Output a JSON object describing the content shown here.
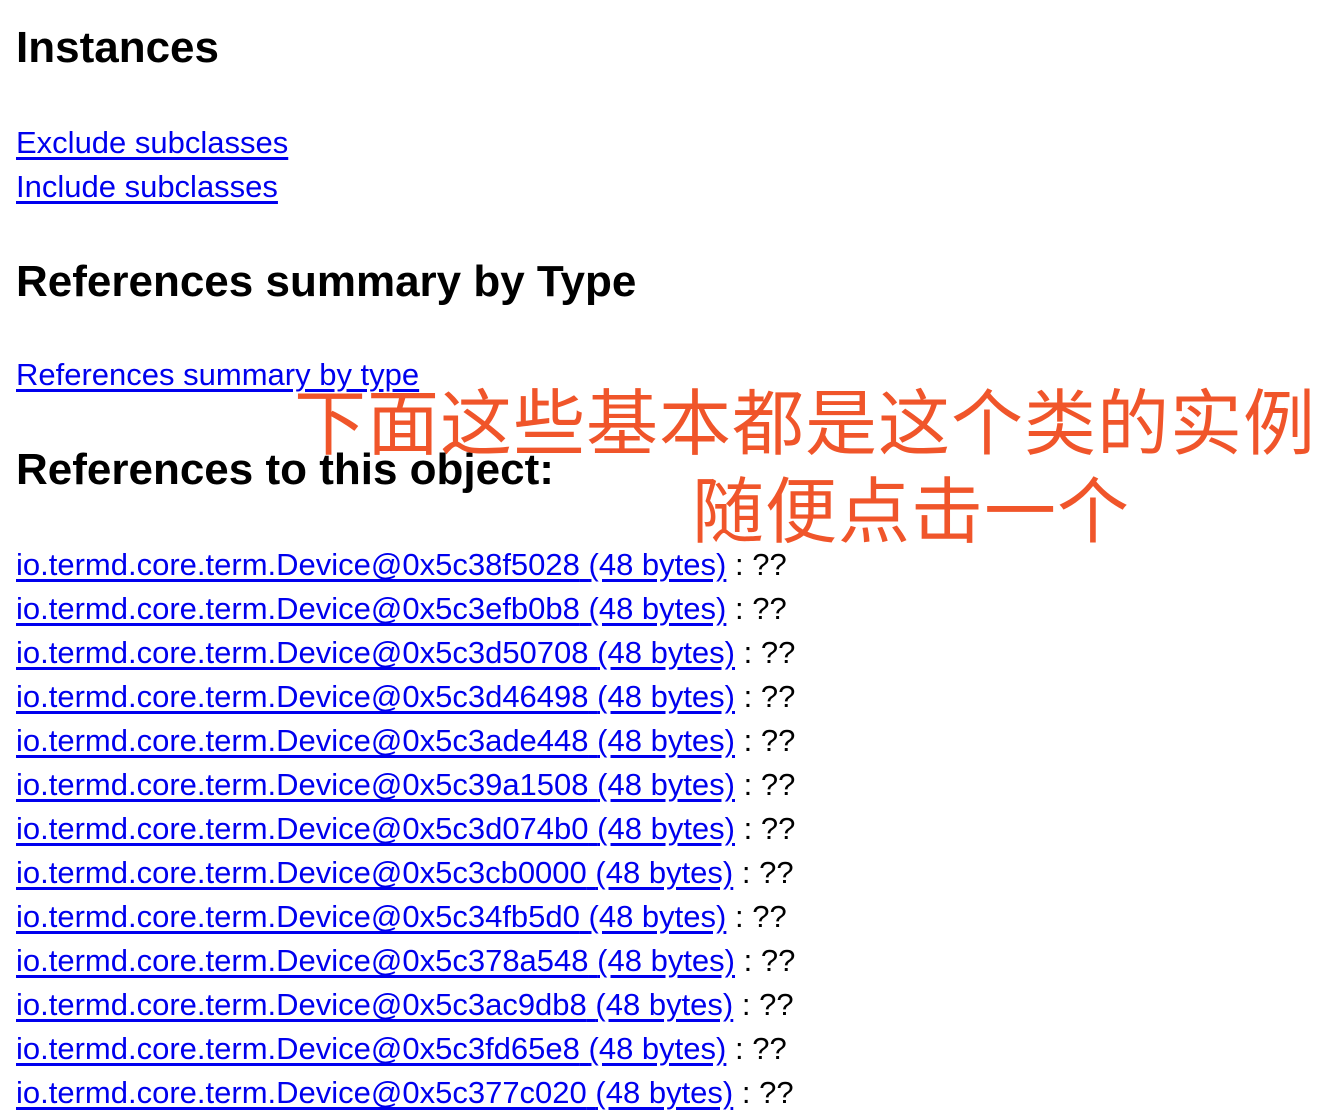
{
  "sections": {
    "instances": {
      "heading": "Instances",
      "links": [
        "Exclude subclasses",
        "Include subclasses"
      ]
    },
    "references_summary": {
      "heading": "References summary by Type",
      "link": "References summary by type"
    },
    "references_to_object": {
      "heading": "References to this object:",
      "items": [
        {
          "object": "io.termd.core.term.Device@0x5c38f5028",
          "size": "(48 bytes)",
          "suffix": " : ??"
        },
        {
          "object": "io.termd.core.term.Device@0x5c3efb0b8",
          "size": "(48 bytes)",
          "suffix": " : ??"
        },
        {
          "object": "io.termd.core.term.Device@0x5c3d50708",
          "size": "(48 bytes)",
          "suffix": " : ??"
        },
        {
          "object": "io.termd.core.term.Device@0x5c3d46498",
          "size": "(48 bytes)",
          "suffix": " : ??"
        },
        {
          "object": "io.termd.core.term.Device@0x5c3ade448",
          "size": "(48 bytes)",
          "suffix": " : ??"
        },
        {
          "object": "io.termd.core.term.Device@0x5c39a1508",
          "size": "(48 bytes)",
          "suffix": " : ??"
        },
        {
          "object": "io.termd.core.term.Device@0x5c3d074b0",
          "size": "(48 bytes)",
          "suffix": " : ??"
        },
        {
          "object": "io.termd.core.term.Device@0x5c3cb0000",
          "size": "(48 bytes)",
          "suffix": " : ??"
        },
        {
          "object": "io.termd.core.term.Device@0x5c34fb5d0",
          "size": "(48 bytes)",
          "suffix": " : ??"
        },
        {
          "object": "io.termd.core.term.Device@0x5c378a548",
          "size": "(48 bytes)",
          "suffix": " : ??"
        },
        {
          "object": "io.termd.core.term.Device@0x5c3ac9db8",
          "size": "(48 bytes)",
          "suffix": " : ??"
        },
        {
          "object": "io.termd.core.term.Device@0x5c3fd65e8",
          "size": "(48 bytes)",
          "suffix": " : ??"
        },
        {
          "object": "io.termd.core.term.Device@0x5c377c020",
          "size": "(48 bytes)",
          "suffix": " : ??"
        }
      ]
    }
  },
  "annotation": {
    "line1": "下面这些基本都是这个类的实例",
    "line2": "随便点击一个",
    "color": "#f0552a"
  },
  "colors": {
    "link": "#0000ee",
    "text": "#000000",
    "background": "#ffffff"
  }
}
